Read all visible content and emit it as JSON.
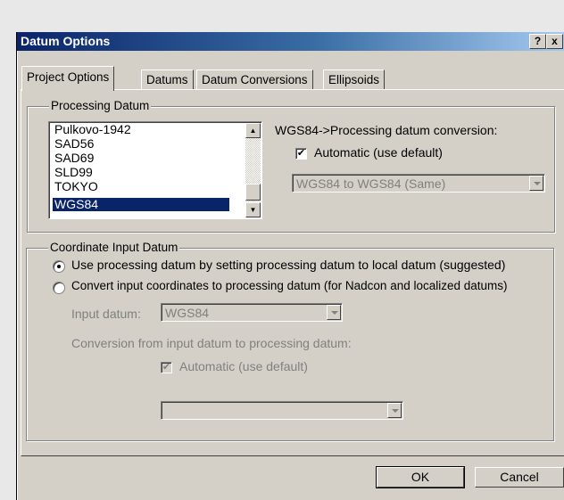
{
  "window": {
    "title": "Datum Options",
    "help_label": "?",
    "close_label": "x"
  },
  "tabs": [
    {
      "label": "Project Options",
      "active": true
    },
    {
      "label": "Datums",
      "active": false
    },
    {
      "label": "Datum Conversions",
      "active": false
    },
    {
      "label": "Ellipsoids",
      "active": false
    }
  ],
  "processing_datum": {
    "group_label": "Processing Datum",
    "items": [
      "Pulkovo-1942",
      "SAD56",
      "SAD69",
      "SLD99",
      "TOKYO",
      "WGS84"
    ],
    "selected": "WGS84",
    "conversion_label": "WGS84->Processing datum conversion:",
    "automatic_label": "Automatic (use default)",
    "automatic_checked": true,
    "conversion_value": "WGS84 to WGS84 (Same)"
  },
  "coordinate_input": {
    "group_label": "Coordinate Input Datum",
    "option_local": "Use processing datum by setting processing datum to local datum (suggested)",
    "option_convert": "Convert input coordinates to processing datum (for Nadcon and localized datums)",
    "selected_option": "local",
    "input_datum_label": "Input datum:",
    "input_datum_value": "WGS84",
    "conversion_label": "Conversion from input datum to processing datum:",
    "automatic_label": "Automatic (use default)",
    "automatic_checked": true,
    "conversion_value": ""
  },
  "buttons": {
    "ok": "OK",
    "cancel": "Cancel"
  },
  "colors": {
    "title_start": "#0a246a",
    "selection": "#0a246a",
    "face": "#d4d0c8"
  }
}
